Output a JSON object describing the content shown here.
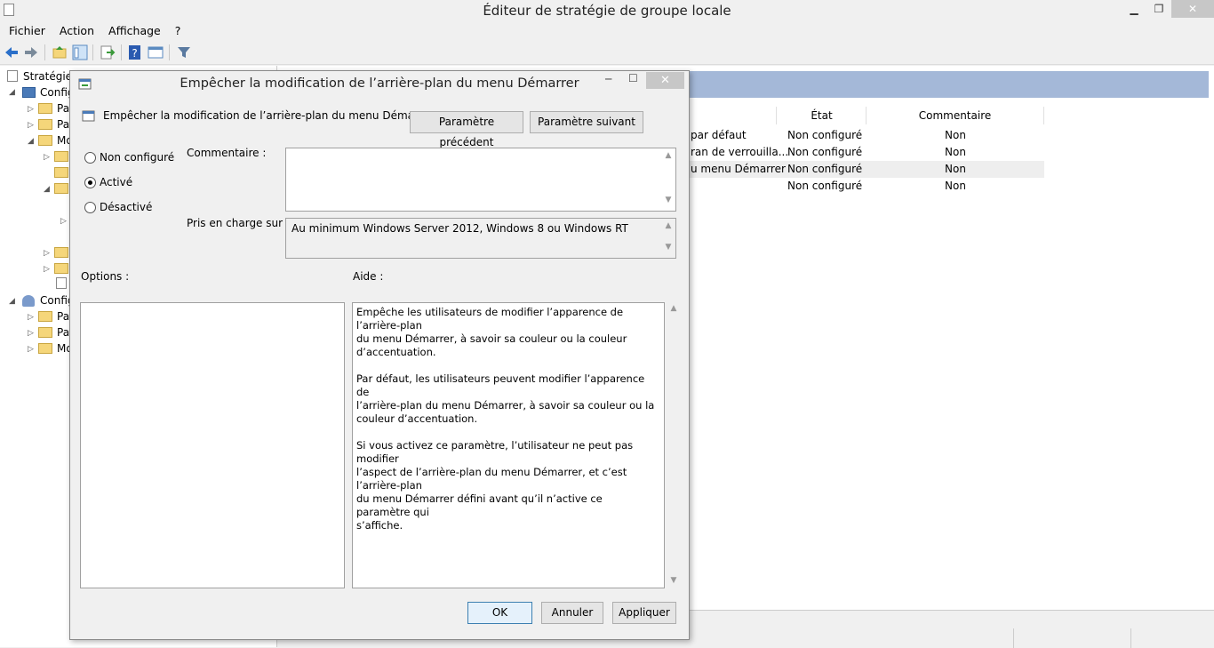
{
  "window": {
    "title": "Éditeur de stratégie de groupe locale"
  },
  "menu": [
    "Fichier",
    "Action",
    "Affichage",
    "?"
  ],
  "tree": {
    "root": "Stratégie G",
    "items": [
      "Config",
      "Pa",
      "Pa",
      "Mo",
      "Config",
      "Pa",
      "Pa",
      "Mo"
    ]
  },
  "list": {
    "headers": {
      "state": "État",
      "comment": "Commentaire"
    },
    "rows": [
      {
        "name": "par défaut",
        "state": "Non configuré",
        "comment": "Non"
      },
      {
        "name": "ran de verrouilla...",
        "state": "Non configuré",
        "comment": "Non"
      },
      {
        "name": "u menu Démarrer",
        "state": "Non configuré",
        "comment": "Non"
      },
      {
        "name": "",
        "state": "Non configuré",
        "comment": "Non"
      }
    ]
  },
  "dialog": {
    "title": "Empêcher la modification de l’arrière-plan du menu Démarrer",
    "setting_name": "Empêcher la modification de l’arrière-plan du menu Démarrer",
    "prev_button": "Paramètre précédent",
    "next_button": "Paramètre suivant",
    "radios": {
      "not_configured": "Non configuré",
      "enabled": "Activé",
      "disabled": "Désactivé",
      "selected": "enabled"
    },
    "comment_label": "Commentaire :",
    "supported_label": "Pris en charge sur :",
    "supported_value": "Au minimum Windows Server 2012, Windows 8 ou Windows RT",
    "options_label": "Options :",
    "help_label": "Aide :",
    "help_text": "Empêche les utilisateurs de modifier l’apparence de l’arrière-plan\ndu menu Démarrer, à savoir sa couleur ou la couleur\nd’accentuation.\n\nPar défaut, les utilisateurs peuvent modifier l’apparence de\nl’arrière-plan du menu Démarrer, à savoir sa couleur ou la\ncouleur d’accentuation.\n\nSi vous activez ce paramètre, l’utilisateur ne peut pas modifier\nl’aspect de l’arrière-plan du menu Démarrer, et c’est l’arrière-plan\ndu menu Démarrer défini avant qu’il n’active ce paramètre qui\ns’affiche.",
    "ok": "OK",
    "cancel": "Annuler",
    "apply": "Appliquer"
  }
}
